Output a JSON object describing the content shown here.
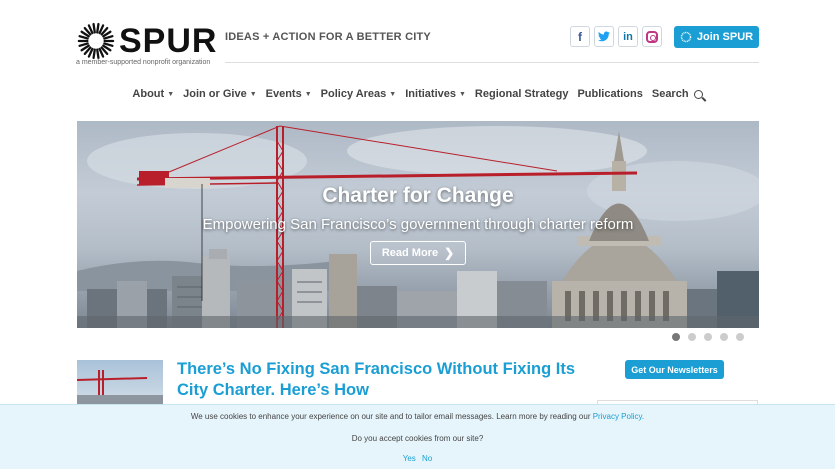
{
  "header": {
    "logo_text": "SPUR",
    "tagline": "IDEAS + ACTION FOR A BETTER CITY",
    "subtagline": "a member-supported nonprofit organization",
    "socials": [
      {
        "icon": "facebook-icon",
        "glyph": "f"
      },
      {
        "icon": "twitter-icon",
        "glyph": "t"
      },
      {
        "icon": "linkedin-icon",
        "glyph": "in"
      },
      {
        "icon": "instagram-icon",
        "glyph": ""
      }
    ],
    "join_label": "Join SPUR"
  },
  "nav": {
    "items": [
      {
        "label": "About",
        "dropdown": true
      },
      {
        "label": "Join or Give",
        "dropdown": true
      },
      {
        "label": "Events",
        "dropdown": true
      },
      {
        "label": "Policy Areas",
        "dropdown": true
      },
      {
        "label": "Initiatives",
        "dropdown": true
      },
      {
        "label": "Regional Strategy",
        "dropdown": false
      },
      {
        "label": "Publications",
        "dropdown": false
      },
      {
        "label": "Search",
        "dropdown": false
      }
    ]
  },
  "hero": {
    "title": "Charter for Change",
    "subtitle": "Empowering San Francisco’s government through charter reform",
    "button_label": "Read More",
    "slides_total": 5,
    "active_slide": 1
  },
  "article": {
    "title": "There’s No Fixing San Francisco Without Fixing Its City Charter. Here’s How"
  },
  "sidebar": {
    "newsletter_label": "Get Our Newsletters"
  },
  "cookie": {
    "text": "We use cookies to enhance your experience on our site and to tailor email messages. Learn more by reading our",
    "link": "Privacy Policy.",
    "question": "Do you accept cookies from our site?",
    "yes": "Yes",
    "no": "No"
  },
  "colors": {
    "accent": "#1a9ed4",
    "crane": "#b81f2a"
  }
}
